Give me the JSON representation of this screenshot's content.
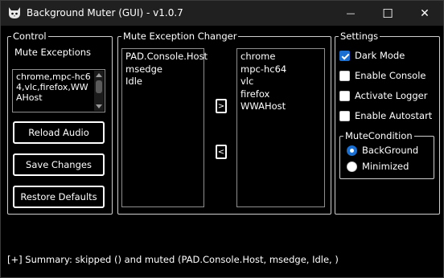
{
  "window": {
    "title": "Background Muter (GUI) - v1.0.7",
    "app_icon": "cat-icon",
    "controls": {
      "minimize": "—",
      "maximize": "☐",
      "close": "✕"
    }
  },
  "control": {
    "legend": "Control",
    "exceptions_label": "Mute Exceptions",
    "exceptions_value": "chrome,mpc-hc64,vlc,firefox,WWAHost",
    "buttons": {
      "reload": "Reload Audio",
      "save": "Save Changes",
      "restore": "Restore Defaults"
    }
  },
  "changer": {
    "legend": "Mute Exception Changer",
    "left_items": [
      "PAD.Console.Host",
      "msedge",
      "Idle"
    ],
    "right_items": [
      "chrome",
      "mpc-hc64",
      "vlc",
      "firefox",
      "WWAHost"
    ],
    "move_right": ">",
    "move_left": "<"
  },
  "settings": {
    "legend": "Settings",
    "options": [
      {
        "label": "Dark Mode",
        "checked": true
      },
      {
        "label": "Enable Console",
        "checked": false
      },
      {
        "label": "Activate Logger",
        "checked": false
      },
      {
        "label": "Enable Autostart",
        "checked": false
      }
    ],
    "mute_condition": {
      "legend": "MuteCondition",
      "options": [
        {
          "label": "BackGround",
          "selected": true
        },
        {
          "label": "Minimized",
          "selected": false
        }
      ]
    }
  },
  "status": {
    "summary": "[+] Summary: skipped () and muted (PAD.Console.Host, msedge, Idle, )"
  },
  "colors": {
    "background": "#000000",
    "titlebar": "#202020",
    "accent": "#1b6fd0",
    "border": "#cfcfcf"
  }
}
